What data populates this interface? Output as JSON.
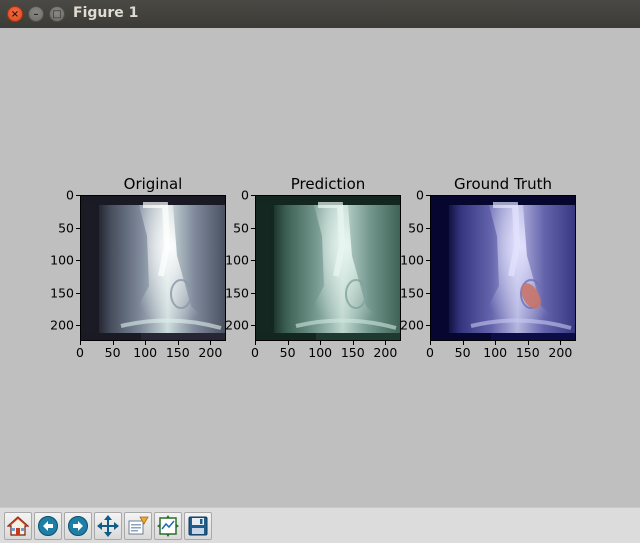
{
  "window": {
    "title": "Figure 1",
    "close_glyph": "×",
    "minimize_glyph": "–",
    "maximize_glyph": "□"
  },
  "figure": {
    "subplots": [
      {
        "title": "Original",
        "image_tint": "bone-gray",
        "x_ticks": [
          "0",
          "50",
          "100",
          "150",
          "200"
        ],
        "y_ticks": [
          "0",
          "50",
          "100",
          "150",
          "200"
        ]
      },
      {
        "title": "Prediction",
        "image_tint": "bone-green",
        "x_ticks": [
          "0",
          "50",
          "100",
          "150",
          "200"
        ],
        "y_ticks": [
          "0",
          "50",
          "100",
          "150",
          "200"
        ]
      },
      {
        "title": "Ground Truth",
        "image_tint": "bone-blue-with-red-mask",
        "x_ticks": [
          "0",
          "50",
          "100",
          "150",
          "200"
        ],
        "y_ticks": [
          "0",
          "50",
          "100",
          "150",
          "200"
        ]
      }
    ]
  },
  "toolbar": {
    "buttons": [
      {
        "name": "home",
        "icon": "home-icon"
      },
      {
        "name": "back",
        "icon": "back-arrow-icon"
      },
      {
        "name": "forward",
        "icon": "forward-arrow-icon"
      },
      {
        "name": "pan",
        "icon": "pan-arrows-icon"
      },
      {
        "name": "zoom",
        "icon": "zoom-rect-icon"
      },
      {
        "name": "subplots",
        "icon": "subplots-config-icon"
      },
      {
        "name": "save",
        "icon": "save-floppy-icon"
      }
    ]
  }
}
